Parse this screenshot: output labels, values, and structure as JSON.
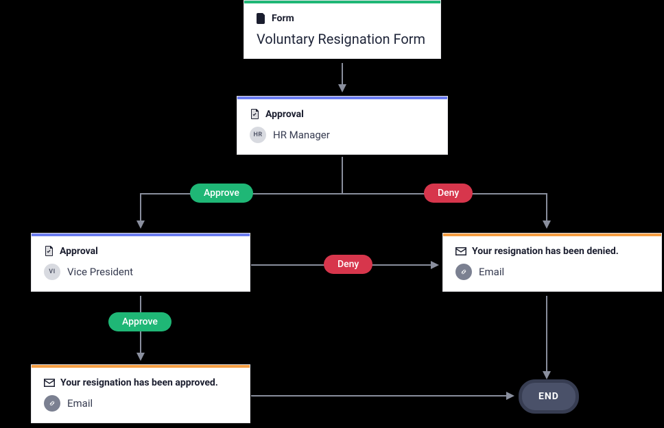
{
  "nodes": {
    "form": {
      "type_label": "Form",
      "title": "Voluntary Resignation Form"
    },
    "approval1": {
      "type_label": "Approval",
      "avatar_initials": "HR",
      "person": "HR Manager"
    },
    "approval2": {
      "type_label": "Approval",
      "avatar_initials": "VI",
      "person": "Vice President"
    },
    "denied": {
      "title": "Your resignation has been denied.",
      "channel": "Email"
    },
    "approved": {
      "title": "Your resignation has been approved.",
      "channel": "Email"
    },
    "end": {
      "label": "END"
    }
  },
  "pills": {
    "approve1": "Approve",
    "deny1": "Deny",
    "approve2": "Approve",
    "deny2": "Deny"
  },
  "colors": {
    "green": "#1fb776",
    "blue": "#6b7cf0",
    "orange": "#f59e42",
    "red": "#d7364c",
    "end_bg": "#4a5169"
  }
}
